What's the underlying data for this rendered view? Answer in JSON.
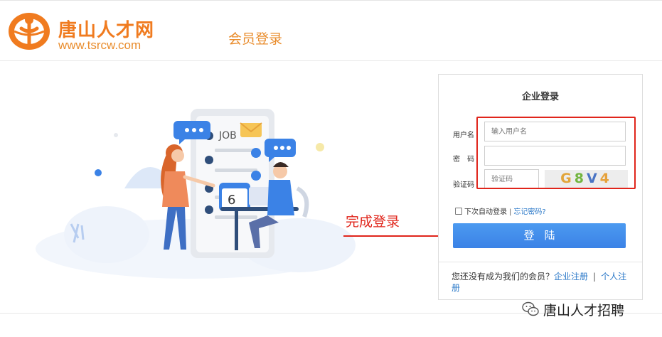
{
  "header": {
    "logo_cn": "唐山人才网",
    "logo_en": "www.tsrcw.com",
    "page_title": "会员登录"
  },
  "illustration": {
    "job_text": "JOB",
    "calendar_number": "6"
  },
  "annotation": {
    "label": "完成登录",
    "color": "#e0251b"
  },
  "login": {
    "title": "企业登录",
    "username_label": "用户名",
    "password_label": "密　码",
    "captcha_label": "验证码",
    "username_placeholder": "输入用户名",
    "captcha_placeholder": "验证码",
    "captcha_chars": [
      "G",
      "8",
      "V",
      "4"
    ],
    "remember_label": "下次自动登录",
    "separator": "|",
    "forgot_label": "忘记密码?",
    "button_label": "登陆",
    "button_color": "#3b82e6",
    "register_prompt": "您还没有成为我们的会员？",
    "register_company": "企业注册",
    "register_separator": "|",
    "register_personal": "个人注册"
  },
  "watermark": {
    "text": "唐山人才招聘",
    "icon": "wechat-icon"
  }
}
